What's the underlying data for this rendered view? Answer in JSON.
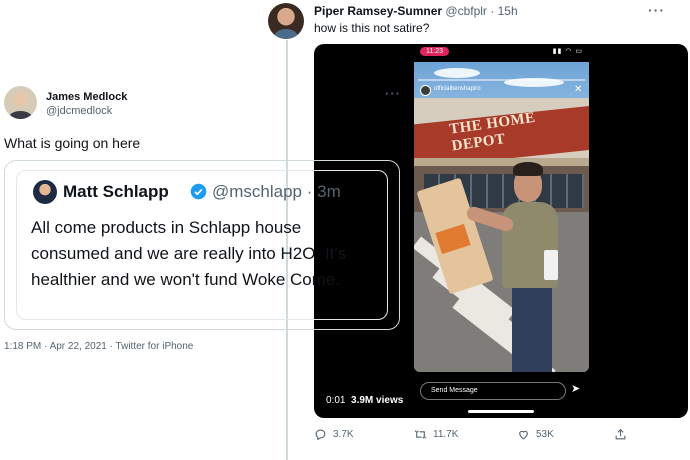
{
  "piper_tweet": {
    "name": "Piper Ramsey-Sumner",
    "handle": "@cbfplr",
    "time": "15h",
    "text": "how is this not satire?",
    "video": {
      "status_time": "11:23",
      "story_user": "officialbenshapiro",
      "store_sign": "THE HOME DEPOT",
      "send_placeholder": "Send Message",
      "duration": "0:01",
      "views": "3.9M views"
    },
    "actions": {
      "replies": "3.7K",
      "retweets": "11.7K",
      "likes": "53K"
    }
  },
  "james_tweet": {
    "name": "James Medlock",
    "handle": "@jdcmedlock",
    "text": "What is going on here",
    "footer": "1:18 PM · Apr 22, 2021 · Twitter for iPhone"
  },
  "quoted_tweet": {
    "name": "Matt Schlapp",
    "handle": "@mschlapp",
    "time": "3m",
    "text": "All come products in Schlapp house consumed and we are really into H2O. It's healthier and we won't fund Woke Come."
  },
  "colors": {
    "verified": "#1d9bf0",
    "muted_text": "#536471",
    "border": "#cfd9de"
  }
}
